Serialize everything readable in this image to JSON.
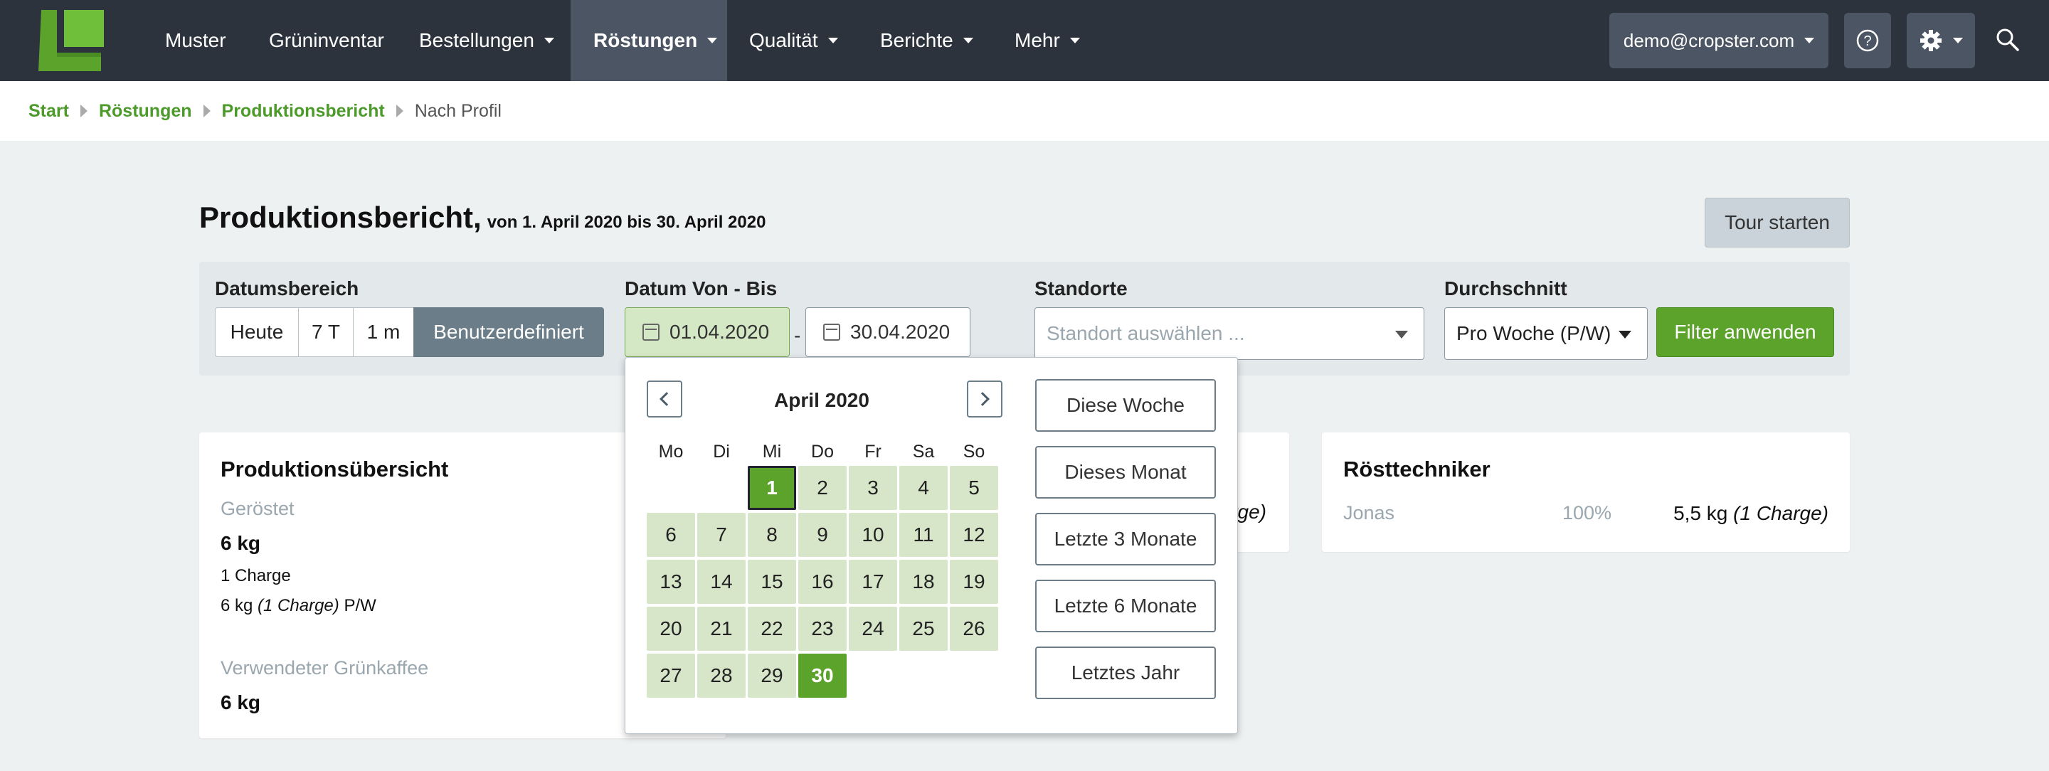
{
  "colors": {
    "brand_green": "#5ba32b",
    "navbar_bg": "#2d333d",
    "active_nav_bg": "#4b5563",
    "link_green": "#4c9a2a"
  },
  "navbar": {
    "logo_icon": "cropster-leaf-logo",
    "items": [
      "Muster",
      "Grüninventar",
      "Bestellungen",
      "Röstungen",
      "Qualität",
      "Berichte",
      "Mehr"
    ],
    "active": "Röstungen",
    "user": "demo@cropster.com",
    "help_icon": "question-circle-icon",
    "settings_icon": "gear-icon",
    "search_icon": "search-icon"
  },
  "breadcrumb": [
    "Start",
    "Röstungen",
    "Produktionsbericht",
    "Nach Profil"
  ],
  "header": {
    "title": "Produktionsbericht,",
    "subtitle": "von 1. April 2020 bis 30. April 2020",
    "tour_button": "Tour starten"
  },
  "filters": {
    "date_range_label": "Datumsbereich",
    "date_range_options": [
      "Heute",
      "7 T",
      "1 m",
      "Benutzerdefiniert"
    ],
    "date_range_selected": "Benutzerdefiniert",
    "from_to_label": "Datum Von - Bis",
    "from": "01.04.2020",
    "separator": "-",
    "to": "30.04.2020",
    "locations_label": "Standorte",
    "locations_placeholder": "Standort auswählen ...",
    "average_label": "Durchschnitt",
    "average_value": "Pro Woche (P/W)",
    "apply_button": "Filter anwenden"
  },
  "overview": {
    "title": "Produktionsübersicht",
    "roasted_label": "Geröstet",
    "roasted_value": "6 kg",
    "batches": "1 Charge",
    "per_week_amount": "6 kg",
    "per_week_batches": "(1 Charge)",
    "per_week_unit": "P/W",
    "green_label": "Verwendeter Grünkaffee",
    "green_value": "6 kg"
  },
  "middle_card": {
    "fragment": "rge)"
  },
  "roasters": {
    "title": "Rösttechniker",
    "name": "Jonas",
    "percent": "100%",
    "amount": "5,5 kg",
    "batches": "(1 Charge)"
  },
  "datepicker": {
    "month": "April 2020",
    "weekdays": [
      "Mo",
      "Di",
      "Mi",
      "Do",
      "Fr",
      "Sa",
      "So"
    ],
    "first_weekday_index": 2,
    "days_in_month": 30,
    "range_start": 1,
    "range_end": 30,
    "days": [
      "1",
      "2",
      "3",
      "4",
      "5",
      "6",
      "7",
      "8",
      "9",
      "10",
      "11",
      "12",
      "13",
      "14",
      "15",
      "16",
      "17",
      "18",
      "19",
      "20",
      "21",
      "22",
      "23",
      "24",
      "25",
      "26",
      "27",
      "28",
      "29",
      "30"
    ],
    "ranges": [
      "Diese Woche",
      "Dieses Monat",
      "Letzte 3 Monate",
      "Letzte 6 Monate",
      "Letztes Jahr"
    ]
  }
}
